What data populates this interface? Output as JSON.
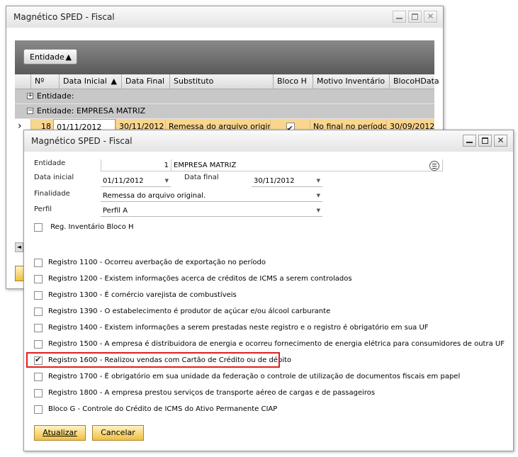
{
  "back_window": {
    "title": "Magnético SPED - Fiscal",
    "group_chip": {
      "label": "Entidade",
      "arrow": "▲"
    },
    "columns": [
      "Nº",
      "Data Inicial",
      "Data Final",
      "Substituto",
      "Bloco H",
      "Motivo Inventário",
      "BlocoHData"
    ],
    "sort_arrow": "▲",
    "groups": [
      {
        "toggle": "+",
        "label": "Entidade:"
      },
      {
        "toggle": "−",
        "label": "Entidade: EMPRESA MATRIZ"
      }
    ],
    "row": {
      "marker": "›",
      "num": "18",
      "data_inicial": "01/11/2012",
      "data_final": "30/11/2012",
      "substituto": "Remessa do arquivo original.",
      "bloco_h": true,
      "motivo": "No final no período",
      "bloco_h_data": "30/09/2012"
    }
  },
  "dialog": {
    "title": "Magnético SPED - Fiscal",
    "entidade": {
      "label": "Entidade",
      "code": "1",
      "name": "EMPRESA MATRIZ"
    },
    "data_inicial": {
      "label": "Data inicial",
      "value": "01/11/2012"
    },
    "data_final": {
      "label": "Data final",
      "value": "30/11/2012"
    },
    "finalidade": {
      "label": "Finalidade",
      "value": "Remessa do arquivo original."
    },
    "perfil": {
      "label": "Perfil",
      "value": "Perfil A"
    },
    "reg_inventario": {
      "label": "Reg. Inventário Bloco H",
      "checked": false
    },
    "registros": [
      {
        "label": "Registro 1100 - Ocorreu averbação de exportação no período",
        "checked": false
      },
      {
        "label": "Registro 1200 - Existem informações acerca de créditos de ICMS a serem controlados",
        "checked": false
      },
      {
        "label": "Registro 1300 - É comércio varejista de combustíveis",
        "checked": false
      },
      {
        "label": "Registro 1390 - O estabelecimento é produtor de açúcar e/ou álcool carburante",
        "checked": false
      },
      {
        "label": "Registro 1400 - Existem informações a serem prestadas neste registro e o registro é obrigatório em sua UF",
        "checked": false
      },
      {
        "label": "Registro 1500 - A empresa é distribuidora de energia e ocorreu fornecimento de energia elétrica para consumidores de outra UF",
        "checked": false
      },
      {
        "label": "Registro 1600 - Realizou vendas com Cartão de Crédito ou de débito",
        "checked": true
      },
      {
        "label": "Registro 1700 - É obrigatório em sua unidade da federação o controle de utilização de documentos fiscais em papel",
        "checked": false
      },
      {
        "label": "Registro 1800 - A empresa prestou serviços de transporte aéreo de cargas e de passageiros",
        "checked": false
      },
      {
        "label": "Bloco G - Controle do Crédito de ICMS do Ativo Permanente CIAP",
        "checked": false
      }
    ],
    "buttons": {
      "update": "Atualizar",
      "cancel": "Cancelar"
    }
  }
}
